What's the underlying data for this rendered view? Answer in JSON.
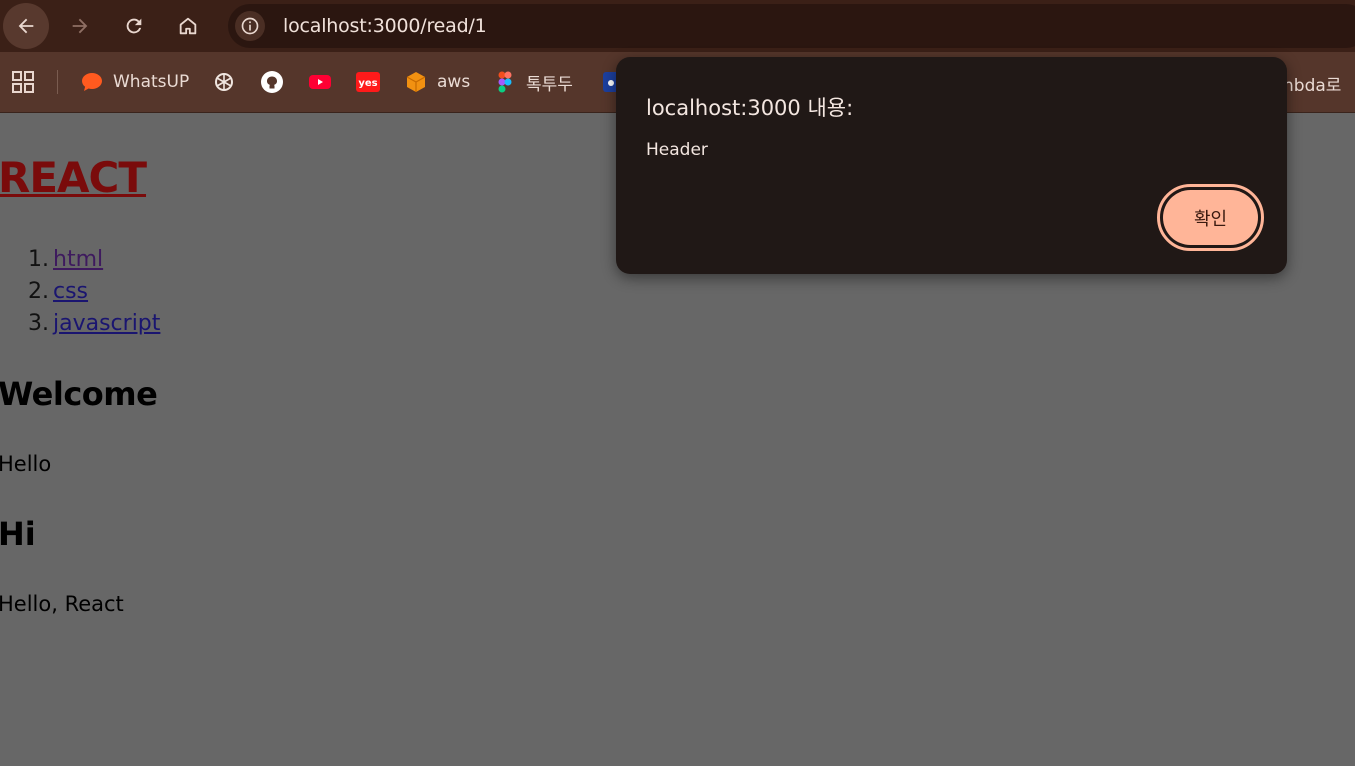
{
  "browser": {
    "url": "localhost:3000/read/1",
    "nav": {
      "back": "back-arrow-icon",
      "forward": "forward-arrow-icon",
      "reload": "reload-icon",
      "home": "home-icon"
    }
  },
  "bookmarks": {
    "items": [
      {
        "label": "WhatsUP",
        "icon": "chat-bubble-icon"
      },
      {
        "label": "",
        "icon": "chatgpt-icon"
      },
      {
        "label": "",
        "icon": "github-icon"
      },
      {
        "label": "",
        "icon": "youtube-icon"
      },
      {
        "label": "",
        "icon": "yes24-icon"
      },
      {
        "label": "aws",
        "icon": "aws-icon"
      },
      {
        "label": "톡투두",
        "icon": "figma-icon"
      },
      {
        "label": "",
        "icon": "blue-app-icon"
      }
    ],
    "tail_label": "nbda로"
  },
  "page": {
    "header": "REACT",
    "nav_links": [
      {
        "num": "1.",
        "label": "html"
      },
      {
        "num": "2.",
        "label": "css"
      },
      {
        "num": "3.",
        "label": "javascript"
      }
    ],
    "article_title": "Welcome",
    "article_body": "Hello",
    "section_title": "Hi",
    "section_body": "Hello, React"
  },
  "dialog": {
    "title": "localhost:3000 내용:",
    "message": "Header",
    "ok_label": "확인"
  },
  "colors": {
    "toolbar_bg": "#3b2017",
    "bookmarks_bg": "#55362b",
    "page_bg": "#676767",
    "dialog_bg": "#201816",
    "button_accent": "#ffb598",
    "header_link": "#7a0b0b"
  }
}
